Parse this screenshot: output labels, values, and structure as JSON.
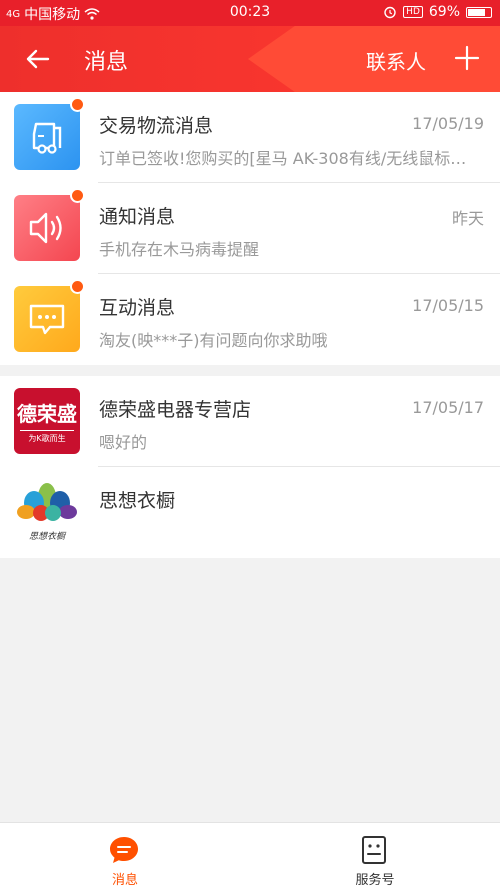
{
  "status_bar": {
    "carrier": "中国移动",
    "signal_label": "4G",
    "time": "00:23",
    "hd_label": "HD",
    "battery": "69%"
  },
  "nav": {
    "back_icon": "arrow-left-icon",
    "title": "消息",
    "contacts_label": "联系人",
    "add_icon": "plus-icon"
  },
  "messages": [
    {
      "icon": "truck-icon",
      "color": "#3a9ff5",
      "name": "交易物流消息",
      "time": "17/05/19",
      "preview": "订单已签收!您购买的[星马 AK-308有线/无线鼠标…",
      "unread": true
    },
    {
      "icon": "speaker-icon",
      "color": "#f85b64",
      "name": "通知消息",
      "time": "昨天",
      "preview": "手机存在木马病毒提醒",
      "unread": true
    },
    {
      "icon": "chat-bubble-icon",
      "color": "#ffb52a",
      "name": "互动消息",
      "time": "17/05/15",
      "preview": "淘友(映***子)有问题向你求助哦",
      "unread": true
    }
  ],
  "shops": [
    {
      "name": "德荣盛电器专营店",
      "time": "17/05/17",
      "preview": "嗯好的",
      "logo_text": "德荣盛",
      "logo_sub": "为K歌而生"
    },
    {
      "name": "思想衣橱",
      "time": "",
      "preview": "",
      "logo_text": "思想衣橱"
    }
  ],
  "tabs": [
    {
      "label": "消息",
      "icon": "message-bubble-icon",
      "active": true,
      "color": "#ff5000"
    },
    {
      "label": "服务号",
      "icon": "service-account-icon",
      "active": false,
      "color": "#333333"
    }
  ]
}
